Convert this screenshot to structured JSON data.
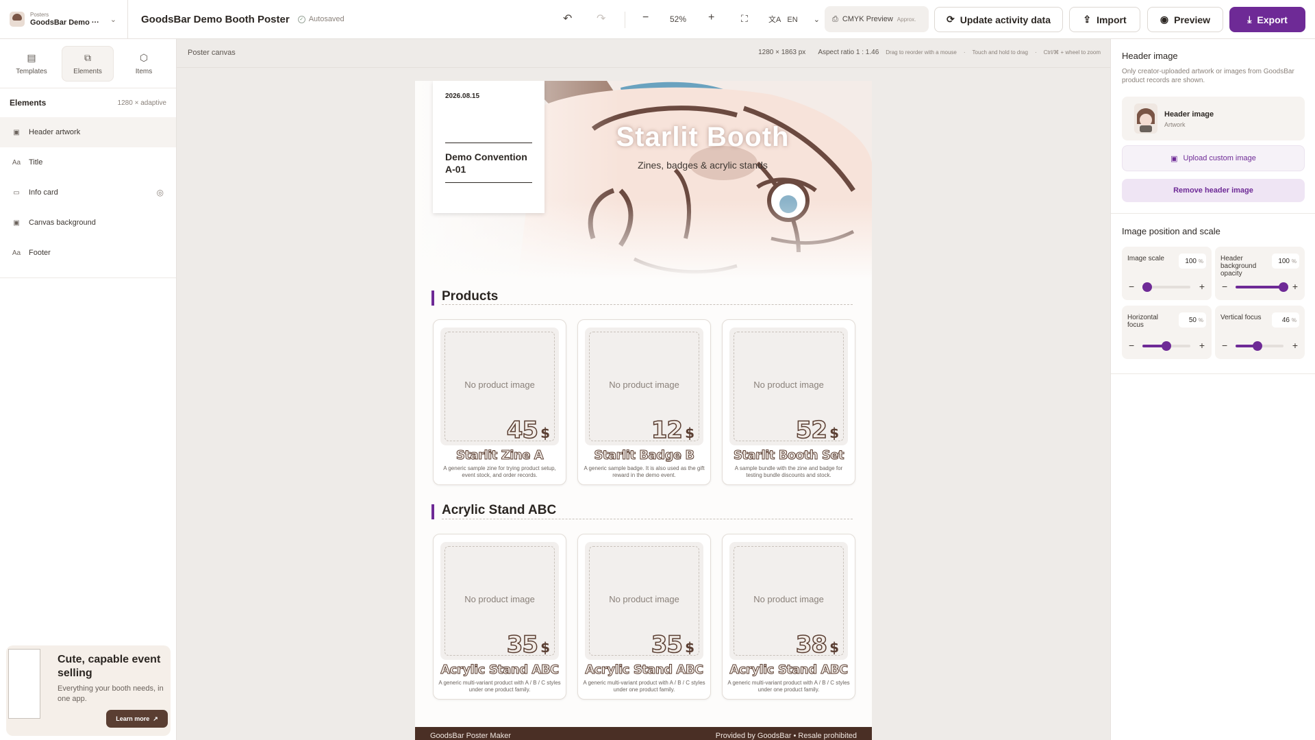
{
  "header": {
    "workspace_kicker": "Posters",
    "workspace_name": "GoodsBar Demo ···",
    "doc_title": "GoodsBar Demo Booth Poster",
    "autosave": "Autosaved",
    "zoom": "52%",
    "lang": "EN",
    "cmyk_label": "CMYK Preview",
    "cmyk_sub": "Approx.",
    "update_label": "Update activity data",
    "import_label": "Import",
    "preview_label": "Preview",
    "export_label": "Export"
  },
  "left": {
    "tabs": [
      {
        "label": "Templates"
      },
      {
        "label": "Elements"
      },
      {
        "label": "Items"
      }
    ],
    "panel_title": "Elements",
    "panel_meta": "1280 × adaptive",
    "elements": [
      {
        "label": "Header artwork"
      },
      {
        "label": "Title"
      },
      {
        "label": "Info card"
      },
      {
        "label": "Canvas background"
      },
      {
        "label": "Footer"
      }
    ],
    "promo": {
      "title": "Cute, capable event selling",
      "text": "Everything your booth needs, in one app.",
      "button": "Learn more"
    }
  },
  "canvas": {
    "label": "Poster canvas",
    "size": "1280 × 1863 px",
    "aspect": "Aspect ratio 1 : 1.46",
    "hint1": "Drag to reorder with a mouse",
    "hint2": "Touch and hold to drag",
    "hint3": "Ctrl/⌘ + wheel to zoom"
  },
  "poster": {
    "date": "2026.08.15",
    "event": "Demo Convention A-01",
    "title": "Starlit Booth",
    "subtitle": "Zines, badges & acrylic stands",
    "sections": [
      {
        "title": "Products",
        "products": [
          {
            "no_image": "No product image",
            "price": "45",
            "currency": "$",
            "name": "Starlit Zine A",
            "desc": "A generic sample zine for trying product setup, event stock, and order records."
          },
          {
            "no_image": "No product image",
            "price": "12",
            "currency": "$",
            "name": "Starlit Badge B",
            "desc": "A generic sample badge. It is also used as the gift reward in the demo event."
          },
          {
            "no_image": "No product image",
            "price": "52",
            "currency": "$",
            "name": "Starlit Booth Set",
            "desc": "A sample bundle with the zine and badge for testing bundle discounts and stock."
          }
        ]
      },
      {
        "title": "Acrylic Stand ABC",
        "products": [
          {
            "no_image": "No product image",
            "price": "35",
            "currency": "$",
            "name": "Acrylic Stand ABC",
            "desc": "A generic multi-variant product with A / B / C styles under one product family."
          },
          {
            "no_image": "No product image",
            "price": "35",
            "currency": "$",
            "name": "Acrylic Stand ABC",
            "desc": "A generic multi-variant product with A / B / C styles under one product family."
          },
          {
            "no_image": "No product image",
            "price": "38",
            "currency": "$",
            "name": "Acrylic Stand ABC",
            "desc": "A generic multi-variant product with A / B / C styles under one product family."
          }
        ]
      }
    ],
    "footer_left": "GoodsBar Poster Maker",
    "footer_right": "Provided by GoodsBar • Resale prohibited"
  },
  "right": {
    "title": "Header image",
    "desc": "Only creator-uploaded artwork or images from GoodsBar product records are shown.",
    "image_name": "Header image",
    "image_sub": "Artwork",
    "upload_label": "Upload custom image",
    "remove_label": "Remove header image",
    "position_title": "Image position and scale",
    "controls": [
      {
        "label": "Image scale",
        "value": "100",
        "fraction": 0.1
      },
      {
        "label": "Header background opacity",
        "value": "100",
        "fraction": 1.0
      },
      {
        "label": "Horizontal focus",
        "value": "50",
        "fraction": 0.5
      },
      {
        "label": "Vertical focus",
        "value": "46",
        "fraction": 0.46
      }
    ]
  },
  "colors": {
    "accent": "#6e2a96",
    "footer": "#4a2f25"
  }
}
